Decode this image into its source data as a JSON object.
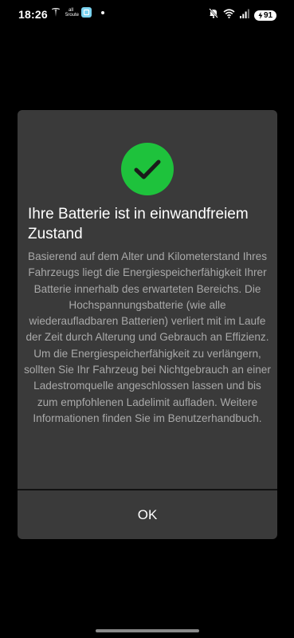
{
  "status_bar": {
    "time": "18:26",
    "network_mini_text_top": "all",
    "network_mini_text_bottom": "5route",
    "battery_level": "91",
    "icons": [
      "tesla-icon",
      "app-icon",
      "notification-dot-icon",
      "mute-icon",
      "wifi-icon",
      "signal-icon",
      "battery-icon"
    ]
  },
  "dialog": {
    "icon": "checkmark-icon",
    "icon_color": "#1ec23c",
    "title": "Ihre Batterie ist in einwandfreiem Zustand",
    "body": "Basierend auf dem Alter und Kilometerstand Ihres Fahrzeugs liegt die Energiespeicherfähigkeit Ihrer Batterie innerhalb des erwarteten Bereichs. Die Hochspannungsbatterie (wie alle wiederaufladbaren Batterien) verliert mit im Laufe der Zeit durch Alterung und Gebrauch an Effizienz. Um die Energiespeicherfähigkeit zu verlängern, sollten Sie Ihr Fahrzeug bei Nichtgebrauch an einer Ladestromquelle angeschlossen lassen und bis zum empfohlenen Ladelimit aufladen. Weitere Informationen finden Sie im Benutzerhandbuch.",
    "ok_label": "OK"
  },
  "colors": {
    "background": "#000000",
    "dialog_background": "#3a3a3a",
    "title_text": "#ffffff",
    "body_text": "#a9a9a9"
  }
}
